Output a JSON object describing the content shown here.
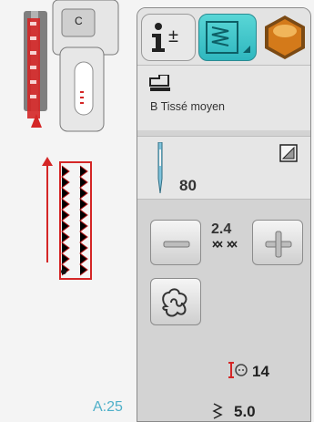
{
  "left_panel": {
    "stitch_count": "A:25"
  },
  "tabs": {
    "info_icon": "info-plus-icon",
    "stitch_icon": "stitch-settings-icon",
    "third_icon": "orange-hexagon-icon"
  },
  "fabric": {
    "icon": "presser-foot-icon",
    "label": "B Tissé moyen"
  },
  "needle": {
    "icon": "needle-icon",
    "size": "80",
    "option_icon": "needle-option-icon"
  },
  "controls": {
    "minus_icon": "minus-icon",
    "stitch_width_value": "2.4",
    "stitch_width_icon": "stitch-width-icon",
    "plus_icon": "plus-icon",
    "pattern_icon": "pattern-sequence-icon",
    "density_icon": "stitch-density-icon",
    "density_value": "14",
    "length_icon": "stitch-length-icon",
    "length_value": "5.0"
  },
  "colors": {
    "accent_tab": "#2fb7bf",
    "info_text": "#4fb0c9",
    "stitch_red": "#cc1f1f",
    "orange": "#d47a1a"
  }
}
